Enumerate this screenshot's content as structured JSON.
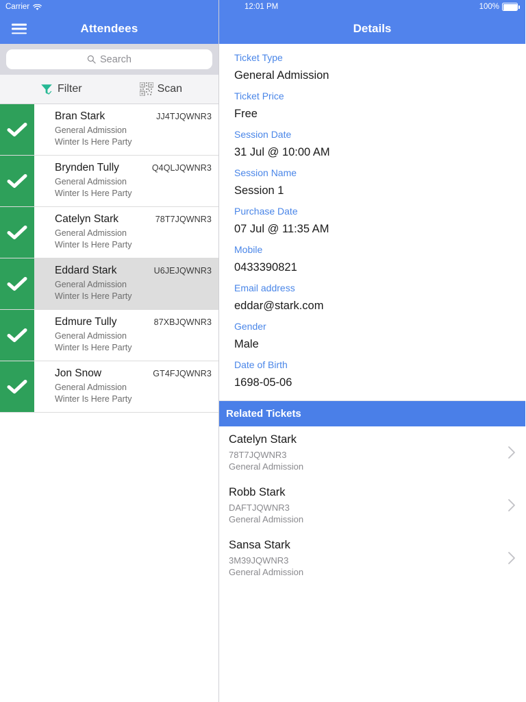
{
  "left": {
    "status_bar": {
      "carrier": "Carrier",
      "wifi_icon": "wifi-icon"
    },
    "navbar": {
      "title": "Attendees",
      "menu_icon": "hamburger-menu-icon"
    },
    "search": {
      "placeholder": "Search",
      "value": "",
      "icon": "search-icon"
    },
    "toolbar": {
      "filter_label": "Filter",
      "filter_icon": "filter-funnel-icon",
      "scan_label": "Scan",
      "scan_icon": "qr-code-scan-icon"
    },
    "attendees": [
      {
        "name": "Bran Stark",
        "code": "JJ4TJQWNR3",
        "ticket_type": "General Admission",
        "event": "Winter Is Here Party",
        "checked_in": true,
        "selected": false
      },
      {
        "name": "Brynden Tully",
        "code": "Q4QLJQWNR3",
        "ticket_type": "General Admission",
        "event": "Winter Is Here Party",
        "checked_in": true,
        "selected": false
      },
      {
        "name": "Catelyn Stark",
        "code": "78T7JQWNR3",
        "ticket_type": "General Admission",
        "event": "Winter Is Here Party",
        "checked_in": true,
        "selected": false
      },
      {
        "name": "Eddard Stark",
        "code": "U6JEJQWNR3",
        "ticket_type": "General Admission",
        "event": "Winter Is Here Party",
        "checked_in": true,
        "selected": true
      },
      {
        "name": "Edmure Tully",
        "code": "87XBJQWNR3",
        "ticket_type": "General Admission",
        "event": "Winter Is Here Party",
        "checked_in": true,
        "selected": false
      },
      {
        "name": "Jon Snow",
        "code": "GT4FJQWNR3",
        "ticket_type": "General Admission",
        "event": "Winter Is Here Party",
        "checked_in": true,
        "selected": false
      }
    ]
  },
  "right": {
    "status_bar": {
      "time": "12:01 PM",
      "battery_percent": "100%",
      "battery_icon": "battery-full-icon"
    },
    "navbar": {
      "title": "Details"
    },
    "fields": [
      {
        "label": "Ticket Type",
        "value": "General Admission"
      },
      {
        "label": "Ticket Price",
        "value": "Free"
      },
      {
        "label": "Session Date",
        "value": "31 Jul @ 10:00 AM"
      },
      {
        "label": "Session Name",
        "value": "Session 1"
      },
      {
        "label": "Purchase Date",
        "value": "07 Jul @ 11:35 AM"
      },
      {
        "label": "Mobile",
        "value": "0433390821"
      },
      {
        "label": "Email address",
        "value": "eddar@stark.com"
      },
      {
        "label": "Gender",
        "value": "Male"
      },
      {
        "label": "Date of Birth",
        "value": "1698-05-06"
      }
    ],
    "related": {
      "header": "Related Tickets",
      "items": [
        {
          "name": "Catelyn Stark",
          "code": "78T7JQWNR3",
          "ticket_type": "General Admission"
        },
        {
          "name": "Robb Stark",
          "code": "DAFTJQWNR3",
          "ticket_type": "General Admission"
        },
        {
          "name": "Sansa Stark",
          "code": "3M39JQWNR3",
          "ticket_type": "General Admission"
        }
      ]
    }
  },
  "colors": {
    "header_blue": "#5183EC",
    "related_header_blue": "#4A7FE8",
    "label_blue": "#4A86E8",
    "check_green": "#2EA05A",
    "filter_teal": "#26B894",
    "selected_row_gray": "#DDDDDD",
    "search_bg": "#D9D9E0"
  }
}
